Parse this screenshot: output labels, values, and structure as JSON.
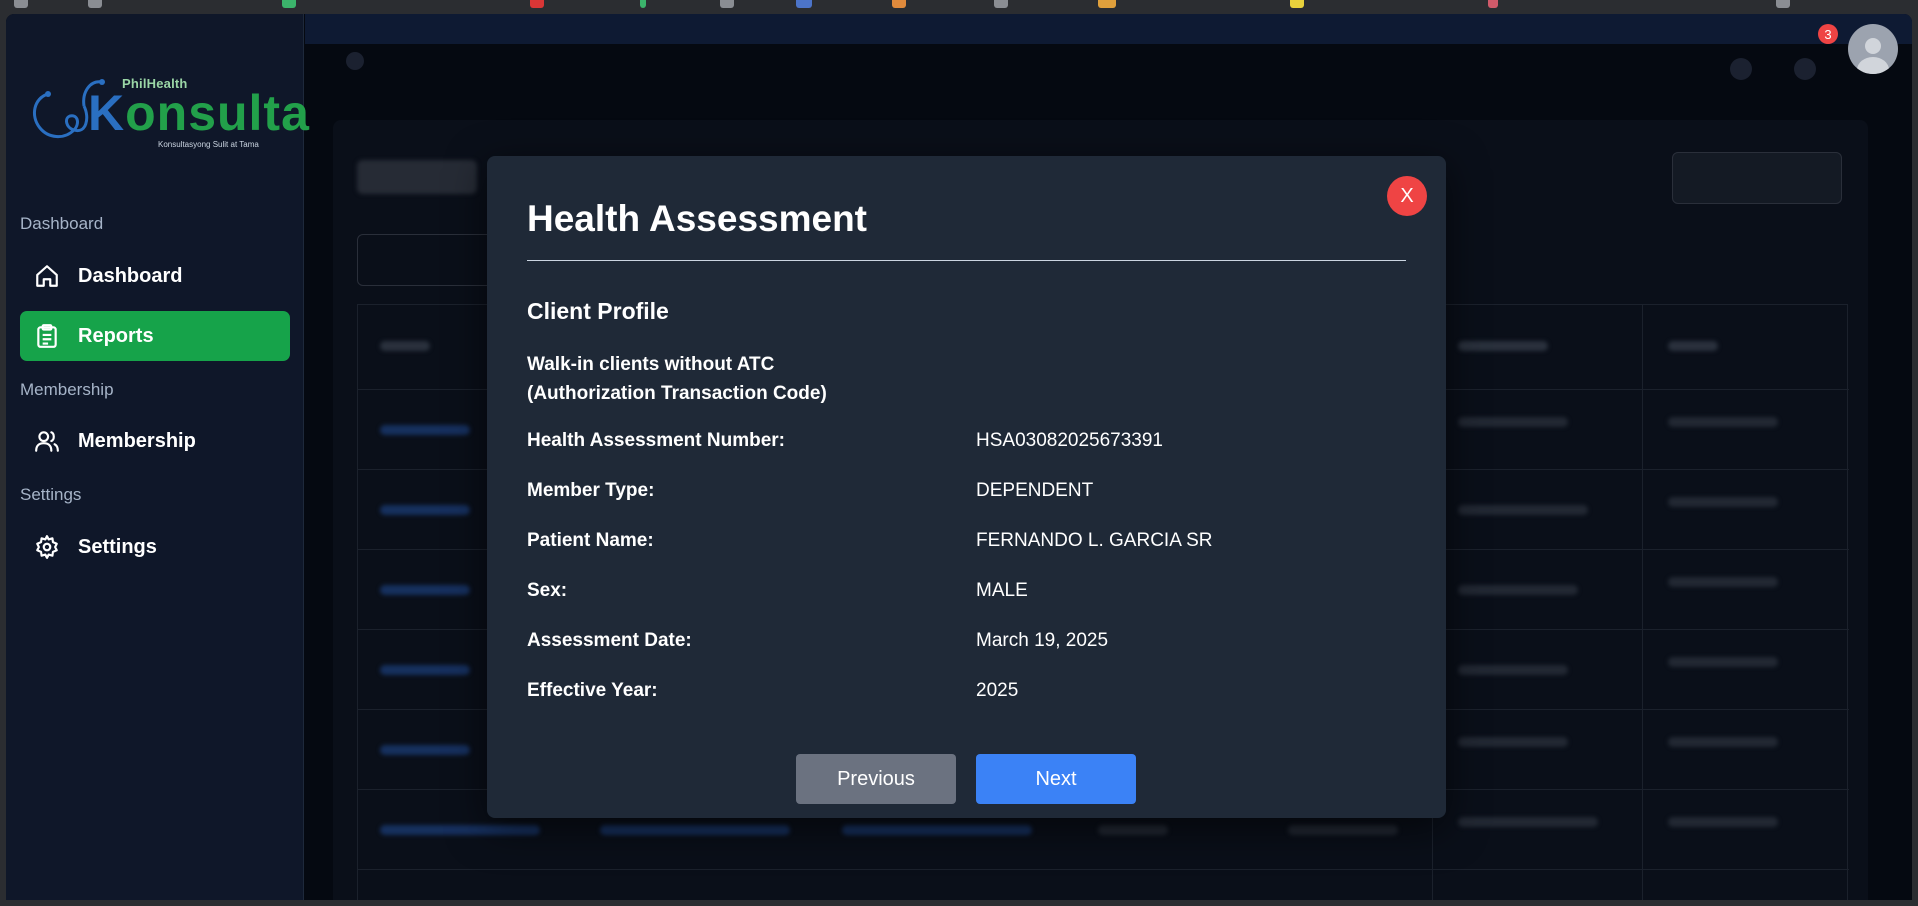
{
  "logo": {
    "brand": "PhilHealth",
    "name_first": "K",
    "name_rest": "onsulta",
    "tagline": "Konsultasyong Sulit at Tama"
  },
  "sidebar": {
    "sections": [
      {
        "label": "Dashboard",
        "items": [
          {
            "label": "Dashboard",
            "icon": "home-icon"
          }
        ]
      },
      {
        "label": "",
        "items": [
          {
            "label": "Reports",
            "icon": "clipboard-icon",
            "active": true
          }
        ]
      },
      {
        "label": "Membership",
        "items": [
          {
            "label": "Membership",
            "icon": "users-icon"
          }
        ]
      },
      {
        "label": "Settings",
        "items": [
          {
            "label": "Settings",
            "icon": "gear-icon"
          }
        ]
      }
    ]
  },
  "header": {
    "notification_count": "3"
  },
  "modal": {
    "title": "Health Assessment",
    "close_label": "X",
    "subtitle": "Client Profile",
    "note_line1": "Walk-in clients without ATC",
    "note_line2": "(Authorization Transaction Code)",
    "fields": [
      {
        "label": "Health Assessment Number:",
        "value": "HSA03082025673391"
      },
      {
        "label": "Member Type:",
        "value": "DEPENDENT"
      },
      {
        "label": "Patient Name:",
        "value": "FERNANDO L. GARCIA SR"
      },
      {
        "label": "Sex:",
        "value": "MALE"
      },
      {
        "label": "Assessment Date:",
        "value": "March 19, 2025"
      },
      {
        "label": "Effective Year:",
        "value": "2025"
      }
    ],
    "prev_label": "Previous",
    "next_label": "Next"
  },
  "colors": {
    "active_nav": "#16a34a",
    "close": "#ef4444",
    "next": "#3b82f6",
    "prev": "#6b7280",
    "modal_bg": "#1f2937"
  }
}
